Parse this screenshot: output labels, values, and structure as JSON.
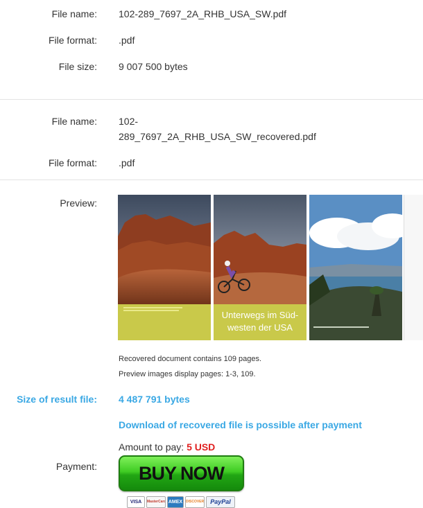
{
  "original": {
    "file_name_label": "File name:",
    "file_name": "102-289_7697_2A_RHB_USA_SW.pdf",
    "file_format_label": "File format:",
    "file_format": ".pdf",
    "file_size_label": "File size:",
    "file_size": "9 007 500 bytes"
  },
  "recovered": {
    "file_name_label": "File name:",
    "file_name_line1": "102-",
    "file_name_line2": "289_7697_2A_RHB_USA_SW_recovered.pdf",
    "file_format_label": "File format:",
    "file_format": ".pdf"
  },
  "preview": {
    "label": "Preview:",
    "thumb2_caption_line1": "Unterwegs im Süd-",
    "thumb2_caption_line2": "westen der USA",
    "pages_note": "Recovered document contains 109 pages.",
    "images_note": "Preview images display pages: 1-3, 109."
  },
  "result": {
    "size_label": "Size of result file:",
    "size_value": "4 487 791 bytes",
    "download_note": "Download of recovered file is possible after payment",
    "amount_label": "Amount to pay:",
    "amount_value": "5 USD"
  },
  "payment": {
    "label": "Payment:",
    "buy_button": "BUY NOW",
    "cards": [
      "VISA",
      "MasterCard",
      "AMEX",
      "DISCOVER",
      "PayPal"
    ]
  },
  "colors": {
    "accent_blue": "#3aa8e4",
    "amount_red": "#e02020",
    "buy_green": "#3fcc23"
  }
}
